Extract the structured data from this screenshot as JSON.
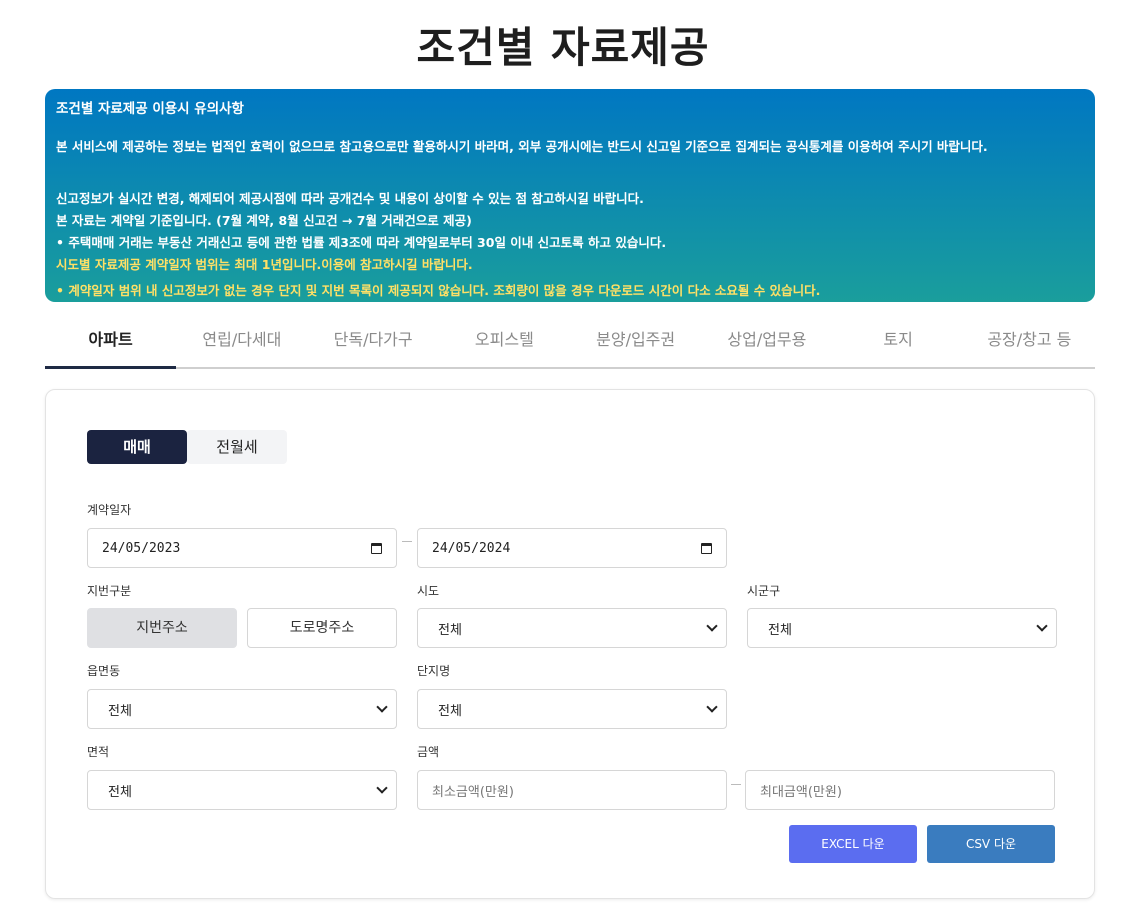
{
  "page": {
    "title": "조건별 자료제공"
  },
  "notice": {
    "title": "조건별 자료제공 이용시 유의사항",
    "line1": "본 서비스에 제공하는 정보는 법적인 효력이 없으므로 참고용으로만 활용하시기 바라며, 외부 공개시에는 반드시 신고일 기준으로 집계되는 공식통계를 이용하여 주시기 바랍니다.",
    "line2": "신고정보가 실시간 변경, 해제되어 제공시점에 따라 공개건수 및 내용이 상이할 수 있는 점 참고하시길 바랍니다.",
    "line3": "본 자료는 계약일 기준입니다. (7월 계약, 8월 신고건 → 7월 거래건으로 제공)",
    "line4": "• 주택매매 거래는 부동산 거래신고 등에 관한 법률 제3조에 따라 계약일로부터 30일 이내 신고토록 하고 있습니다.",
    "line5": "시도별 자료제공 계약일자 범위는 최대 1년입니다.이용에 참고하시길 바랍니다.",
    "line6": "• 계약일자 범위 내 신고정보가 없는 경우 단지 및 지번 목록이 제공되지 않습니다. 조회량이 많을 경우 다운로드 시간이 다소 소요될 수 있습니다.",
    "highlight_color": "#ffe066"
  },
  "tabs": [
    "아파트",
    "연립/다세대",
    "단독/다가구",
    "오피스텔",
    "분양/입주권",
    "상업/업무용",
    "토지",
    "공장/창고 등"
  ],
  "active_tab": "아파트",
  "trade_toggle": {
    "sale": "매매",
    "rent": "전월세",
    "selected": "매매"
  },
  "form": {
    "contract_date_label": "계약일자",
    "date_from": "24/05/2023",
    "date_to": "24/05/2024",
    "lot_type_label": "지번구분",
    "lot_type_options": {
      "jibun": "지번주소",
      "road": "도로명주소"
    },
    "lot_type_selected": "지번주소",
    "sido_label": "시도",
    "sido_value": "전체",
    "sigungu_label": "시군구",
    "sigungu_value": "전체",
    "eupmyeondong_label": "읍면동",
    "eupmyeondong_value": "전체",
    "complex_label": "단지명",
    "complex_value": "전체",
    "area_label": "면적",
    "area_value": "전체",
    "amount_label": "금액",
    "min_amount_placeholder": "최소금액(만원)",
    "max_amount_placeholder": "최대금액(만원)"
  },
  "actions": {
    "excel": "EXCEL 다운",
    "csv": "CSV 다운"
  },
  "colors": {
    "primary_dark": "#1b2340",
    "excel_button": "#5b6df0",
    "csv_button": "#3a7cbf",
    "notice_top": "#0077c2",
    "notice_bottom": "#1a9e9c"
  }
}
